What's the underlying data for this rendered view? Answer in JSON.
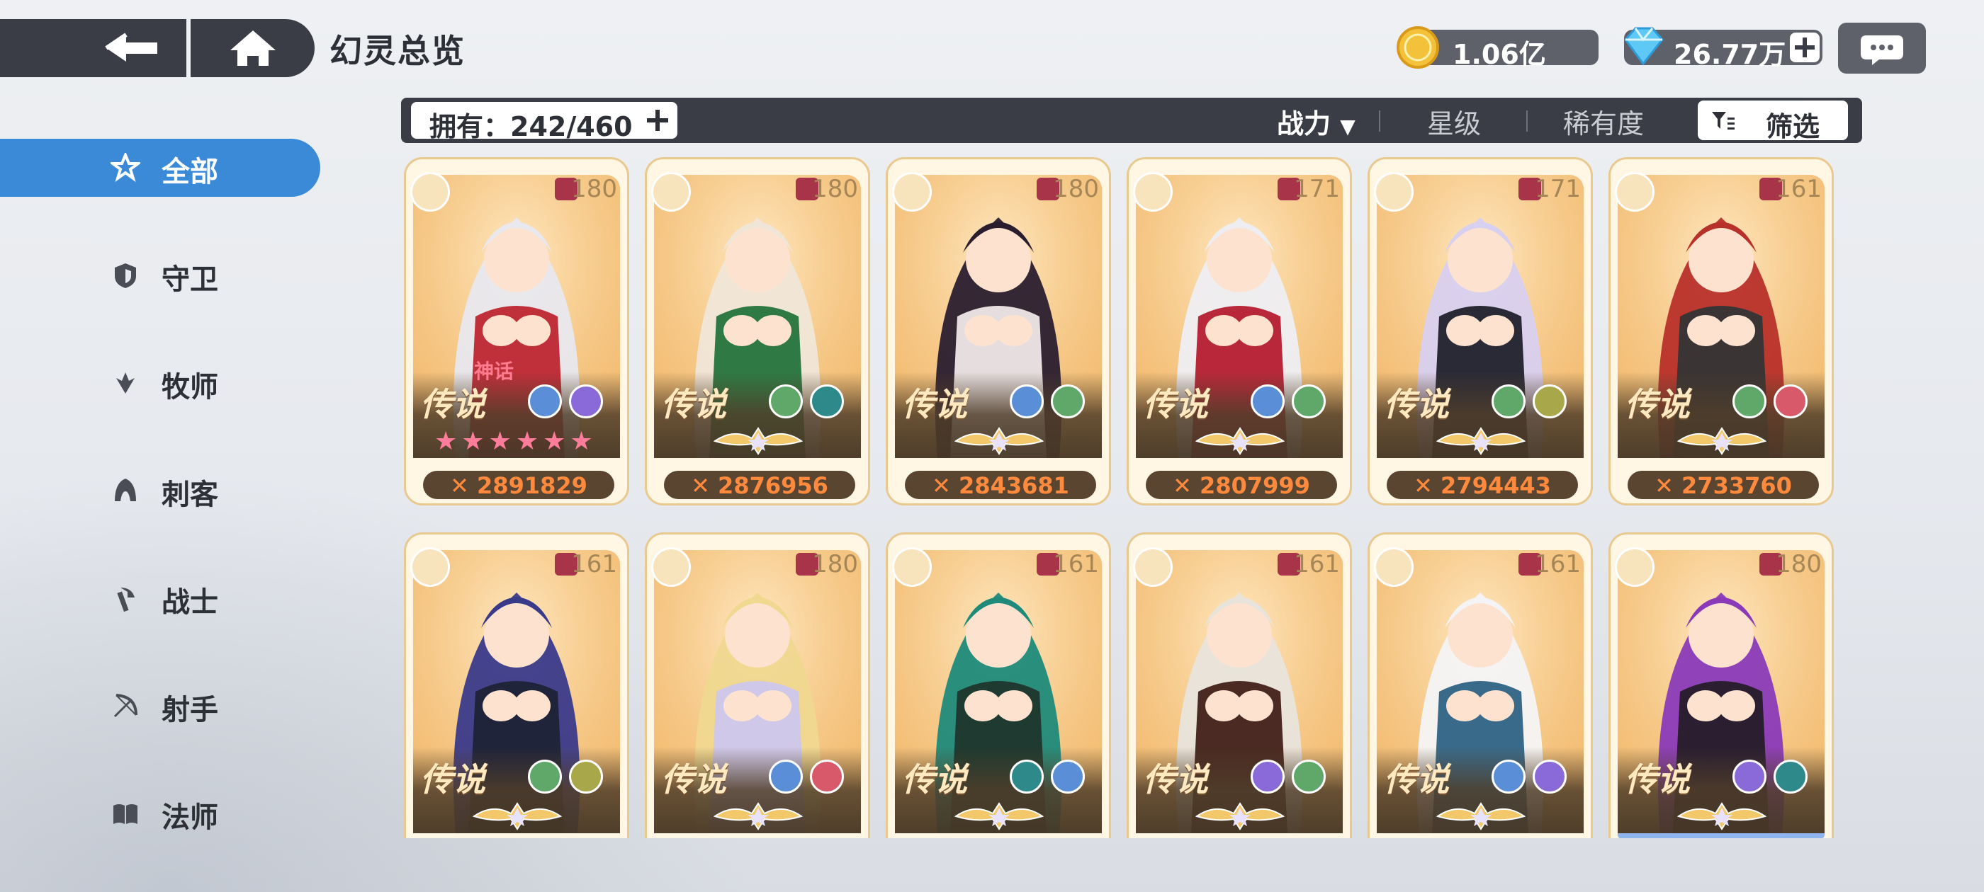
{
  "header": {
    "title": "幻灵总览",
    "gold": "1.06亿",
    "gems": "26.77万"
  },
  "sidebar": {
    "items": [
      {
        "label": "全部",
        "icon": "all-star-icon"
      },
      {
        "label": "守卫",
        "icon": "shield-icon"
      },
      {
        "label": "牧师",
        "icon": "wing-icon"
      },
      {
        "label": "刺客",
        "icon": "hood-icon"
      },
      {
        "label": "战士",
        "icon": "axe-icon"
      },
      {
        "label": "射手",
        "icon": "bow-icon"
      },
      {
        "label": "法师",
        "icon": "book-icon"
      }
    ]
  },
  "filter": {
    "own_text": "拥有：242/460",
    "sort_power": "战力",
    "sort_star": "星级",
    "sort_rarity": "稀有度",
    "filter_label": "筛选"
  },
  "cards": [
    {
      "level": "180",
      "tier": "传说",
      "power": "2891829",
      "myth": "神话",
      "stars": "★★★★★★",
      "role_icon": "bow-icon",
      "gem1": "#5a8fd8",
      "gem2": "#8a6ad8",
      "hair": "#e8e8ee",
      "outfit": "#c0303a"
    },
    {
      "level": "180",
      "tier": "传说",
      "power": "2876956",
      "myth": "",
      "stars": "",
      "role_icon": "bow-icon",
      "gem1": "#5fa86a",
      "gem2": "#2e8a8a",
      "hair": "#f0e6d8",
      "outfit": "#2f7a44"
    },
    {
      "level": "180",
      "tier": "传说",
      "power": "2843681",
      "myth": "",
      "stars": "",
      "role_icon": "bow-icon",
      "gem1": "#5a8fd8",
      "gem2": "#5fa86a",
      "hair": "#2a1e2e",
      "outfit": "#e6dede"
    },
    {
      "level": "171",
      "tier": "传说",
      "power": "2807999",
      "myth": "",
      "stars": "",
      "role_icon": "book-icon",
      "gem1": "#5a8fd8",
      "gem2": "#5fa86a",
      "hair": "#eeeef2",
      "outfit": "#b8283a"
    },
    {
      "level": "171",
      "tier": "传说",
      "power": "2794443",
      "myth": "",
      "stars": "",
      "role_icon": "book-icon",
      "gem1": "#5fa86a",
      "gem2": "#a8a84a",
      "hair": "#d8d0f0",
      "outfit": "#2a2a36"
    },
    {
      "level": "161",
      "tier": "传说",
      "power": "2733760",
      "myth": "",
      "stars": "",
      "role_icon": "shield-icon",
      "gem1": "#5fa86a",
      "gem2": "#d85a6a",
      "hair": "#b8302a",
      "outfit": "#3a3434"
    },
    {
      "level": "161",
      "tier": "传说",
      "power": "",
      "myth": "",
      "stars": "",
      "role_icon": "axe-icon",
      "gem1": "#5fa86a",
      "gem2": "#a8a84a",
      "hair": "#3a3a8a",
      "outfit": "#20243a"
    },
    {
      "level": "180",
      "tier": "传说",
      "power": "",
      "myth": "",
      "stars": "",
      "role_icon": "bow-icon",
      "gem1": "#5a8fd8",
      "gem2": "#d85a6a",
      "hair": "#f0d890",
      "outfit": "#d0c8e8"
    },
    {
      "level": "161",
      "tier": "传说",
      "power": "",
      "myth": "",
      "stars": "",
      "role_icon": "axe-icon",
      "gem1": "#2e8a8a",
      "gem2": "#5a8fd8",
      "hair": "#1f8a7a",
      "outfit": "#1f3a30"
    },
    {
      "level": "161",
      "tier": "传说",
      "power": "",
      "myth": "",
      "stars": "",
      "role_icon": "hood-icon",
      "gem1": "#8a6ad8",
      "gem2": "#5fa86a",
      "hair": "#e8e4dc",
      "outfit": "#4a2a22"
    },
    {
      "level": "161",
      "tier": "传说",
      "power": "",
      "myth": "",
      "stars": "",
      "role_icon": "shield-icon",
      "gem1": "#5a8fd8",
      "gem2": "#8a6ad8",
      "hair": "#f4f4f6",
      "outfit": "#3a6a8a"
    },
    {
      "level": "180",
      "tier": "传说",
      "power": "",
      "myth": "",
      "stars": "",
      "role_icon": "bow-icon",
      "gem1": "#8a6ad8",
      "gem2": "#2e8a8a",
      "hair": "#8a3ab8",
      "outfit": "#2a1e30"
    }
  ]
}
